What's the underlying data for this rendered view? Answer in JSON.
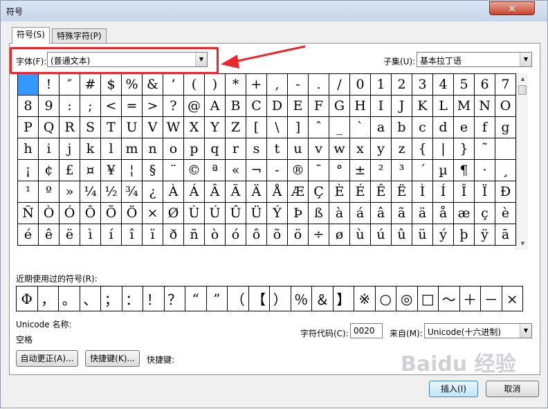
{
  "window": {
    "title": "符号",
    "close_icon": "×"
  },
  "tabs": [
    {
      "label": "符号(S)"
    },
    {
      "label": "特殊字符(P)"
    }
  ],
  "font": {
    "label": "字体(F):",
    "value": "(普通文本)"
  },
  "subset": {
    "label": "子集(U):",
    "value": "基本拉丁语"
  },
  "symbols": [
    " ",
    "!",
    "″",
    "#",
    "$",
    "%",
    "&",
    "’",
    "(",
    ")",
    "*",
    "+",
    ",",
    "-",
    ".",
    "/",
    "0",
    "1",
    "2",
    "3",
    "4",
    "5",
    "6",
    "7",
    "8",
    "9",
    ":",
    ";",
    "<",
    "=",
    ">",
    "?",
    "@",
    "A",
    "B",
    "C",
    "D",
    "E",
    "F",
    "G",
    "H",
    "I",
    "J",
    "K",
    "L",
    "M",
    "N",
    "O",
    "P",
    "Q",
    "R",
    "S",
    "T",
    "U",
    "V",
    "W",
    "X",
    "Y",
    "Z",
    "[",
    "\\",
    "]",
    "ˆ",
    "_",
    "`",
    "a",
    "b",
    "c",
    "d",
    "e",
    "f",
    "g",
    "h",
    "i",
    "j",
    "k",
    "l",
    "m",
    "n",
    "o",
    "p",
    "q",
    "r",
    "s",
    "t",
    "u",
    "v",
    "w",
    "x",
    "y",
    "z",
    "{",
    "|",
    "}",
    "˜",
    " ",
    "¡",
    "¢",
    "£",
    "¤",
    "¥",
    "¦",
    "§",
    "¨",
    "©",
    "ª",
    "«",
    "¬",
    "-",
    "®",
    "¯",
    "°",
    "±",
    "²",
    "³",
    "´",
    "µ",
    "¶",
    "·",
    "¸",
    "¹",
    "º",
    "»",
    "¼",
    "½",
    "¾",
    "¿",
    "À",
    "Á",
    "Â",
    "Ã",
    "Ä",
    "Å",
    "Æ",
    "Ç",
    "È",
    "É",
    "Ê",
    "Ë",
    "Ì",
    "Í",
    "Î",
    "Ï",
    "Ð",
    "Ñ",
    "Ò",
    "Ó",
    "Ô",
    "Õ",
    "Ö",
    "×",
    "Ø",
    "Ù",
    "Ú",
    "Û",
    "Ü",
    "Ý",
    "Þ",
    "ß",
    "à",
    "á",
    "â",
    "ã",
    "ä",
    "å",
    "æ",
    "ç",
    "è",
    "é",
    "ê",
    "ë",
    "ì",
    "í",
    "î",
    "ï",
    "ð",
    "ñ",
    "ò",
    "ó",
    "ô",
    "õ",
    "ö",
    "÷",
    "ø",
    "ù",
    "ú",
    "û",
    "ü",
    "ý",
    "þ",
    "ÿ",
    "ā"
  ],
  "recent": {
    "label": "近期使用过的符号(R):",
    "items": [
      "Φ",
      "，",
      "。",
      "、",
      "；",
      "：",
      "！",
      "？",
      "“",
      "”",
      "（",
      "【",
      "）",
      "％",
      "＆",
      "】",
      "※",
      "○",
      "◎",
      "□",
      "～",
      "＋",
      "－",
      "×"
    ]
  },
  "unicode_name": {
    "label": "Unicode 名称:",
    "value": "空格"
  },
  "char_code": {
    "label": "字符代码(C):",
    "value": "0020"
  },
  "from": {
    "label": "来自(M):",
    "value": "Unicode(十六进制)"
  },
  "buttons": {
    "autocorrect": "自动更正(A)...",
    "shortcut_key": "快捷键(K)...",
    "shortcut_label": "快捷键:",
    "insert": "插入(I)",
    "cancel": "取消"
  },
  "watermark": "Baidu 经验",
  "colors": {
    "highlight": "#e8262c",
    "selection": "#3399ff"
  }
}
